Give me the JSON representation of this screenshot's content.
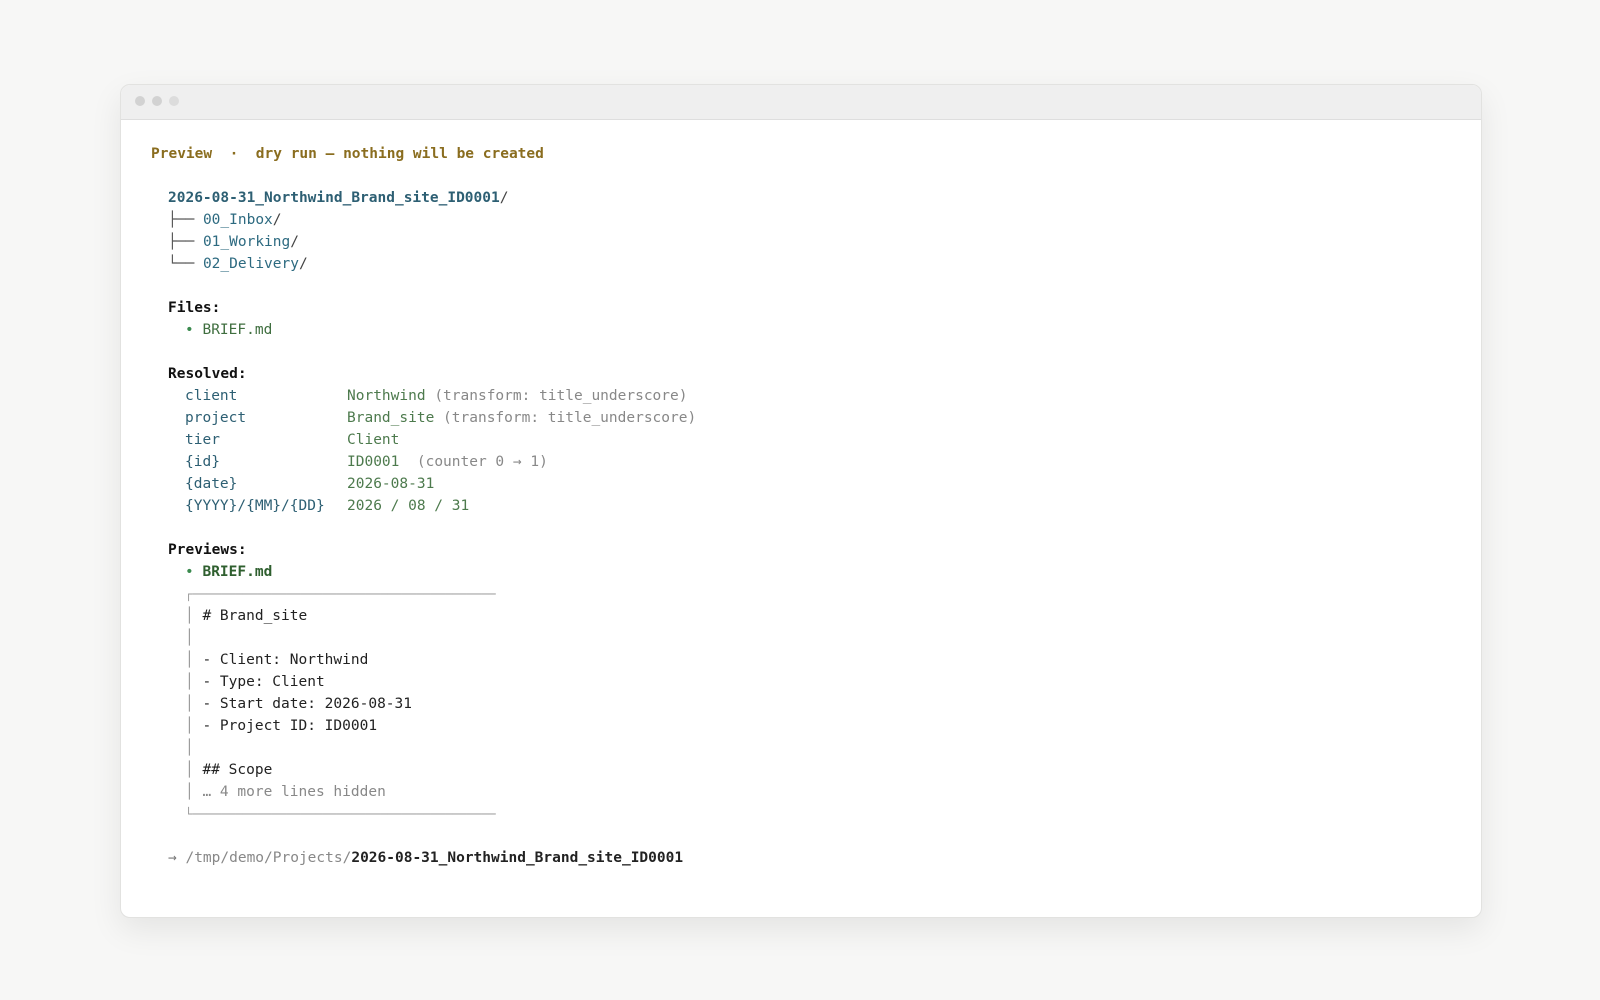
{
  "header": {
    "label": "Preview",
    "separator": "·",
    "note": "dry run — nothing will be created"
  },
  "tree": {
    "root": "2026-08-31_Northwind_Brand_site_ID0001",
    "children": [
      {
        "branch": "├──",
        "name": "00_Inbox"
      },
      {
        "branch": "├──",
        "name": "01_Working"
      },
      {
        "branch": "└──",
        "name": "02_Delivery"
      }
    ]
  },
  "files": {
    "heading": "Files:",
    "items": [
      "BRIEF.md"
    ]
  },
  "resolved": {
    "heading": "Resolved:",
    "rows": [
      {
        "key": "client",
        "value": "Northwind",
        "note": "(transform: title_underscore)"
      },
      {
        "key": "project",
        "value": "Brand_site",
        "note": "(transform: title_underscore)"
      },
      {
        "key": "tier",
        "value": "Client",
        "note": ""
      },
      {
        "key": "{id}",
        "value": "ID0001",
        "note": "(counter 0 → 1)"
      },
      {
        "key": "{date}",
        "value": "2026-08-31",
        "note": ""
      },
      {
        "key": "{YYYY}/{MM}/{DD}",
        "value": "2026 / 08 / 31",
        "note": ""
      }
    ]
  },
  "previews": {
    "heading": "Previews:",
    "file": "BRIEF.md",
    "box_top": "┌──────────────────────────────────────────",
    "box_bottom": "└──────────────────────────────────────────",
    "box_side": "│",
    "lines": [
      "# Brand_site",
      "",
      "- Client: Northwind",
      "- Type: Client",
      "- Start date: 2026-08-31",
      "- Project ID: ID0001",
      "",
      "## Scope"
    ],
    "hidden_note": "… 4 more lines hidden"
  },
  "footer": {
    "arrow": "→",
    "path_prefix": "/tmp/demo/Projects/",
    "path_name": "2026-08-31_Northwind_Brand_site_ID0001"
  }
}
